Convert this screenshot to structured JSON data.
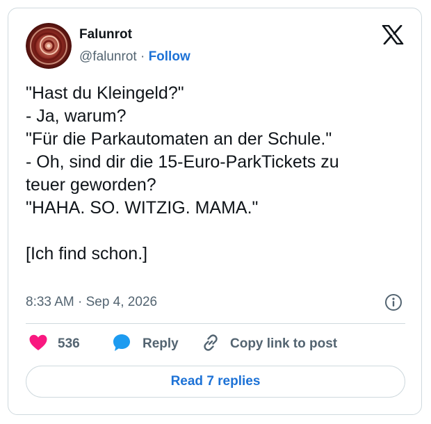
{
  "author": {
    "display_name": "Falunrot",
    "handle": "@falunrot",
    "separator": " · ",
    "follow_label": "Follow"
  },
  "tweet": {
    "lines": [
      "\"Hast du Kleingeld?\"",
      "- Ja, warum?",
      "\"Für die Parkautomaten an der Schule.\"",
      "- Oh, sind dir die 15-Euro-ParkTickets zu",
      "teuer geworden?",
      "\"HAHA. SO. WITZIG. MAMA.\"",
      "",
      "[Ich find schon.]"
    ],
    "timestamp": "8:33 AM · Sep 4, 2026"
  },
  "actions": {
    "like_count": "536",
    "reply_label": "Reply",
    "copy_label": "Copy link to post"
  },
  "footer": {
    "read_replies_label": "Read 7 replies"
  },
  "icons": {
    "logo": "x-logo-icon",
    "info": "info-icon",
    "like": "heart-icon",
    "reply": "speech-bubble-icon",
    "copy": "link-icon"
  },
  "colors": {
    "link": "#1d72d6",
    "secondary_text": "#536471",
    "heart": "#f91880",
    "reply_bubble": "#1d9bf0",
    "border": "#cfd9de"
  }
}
